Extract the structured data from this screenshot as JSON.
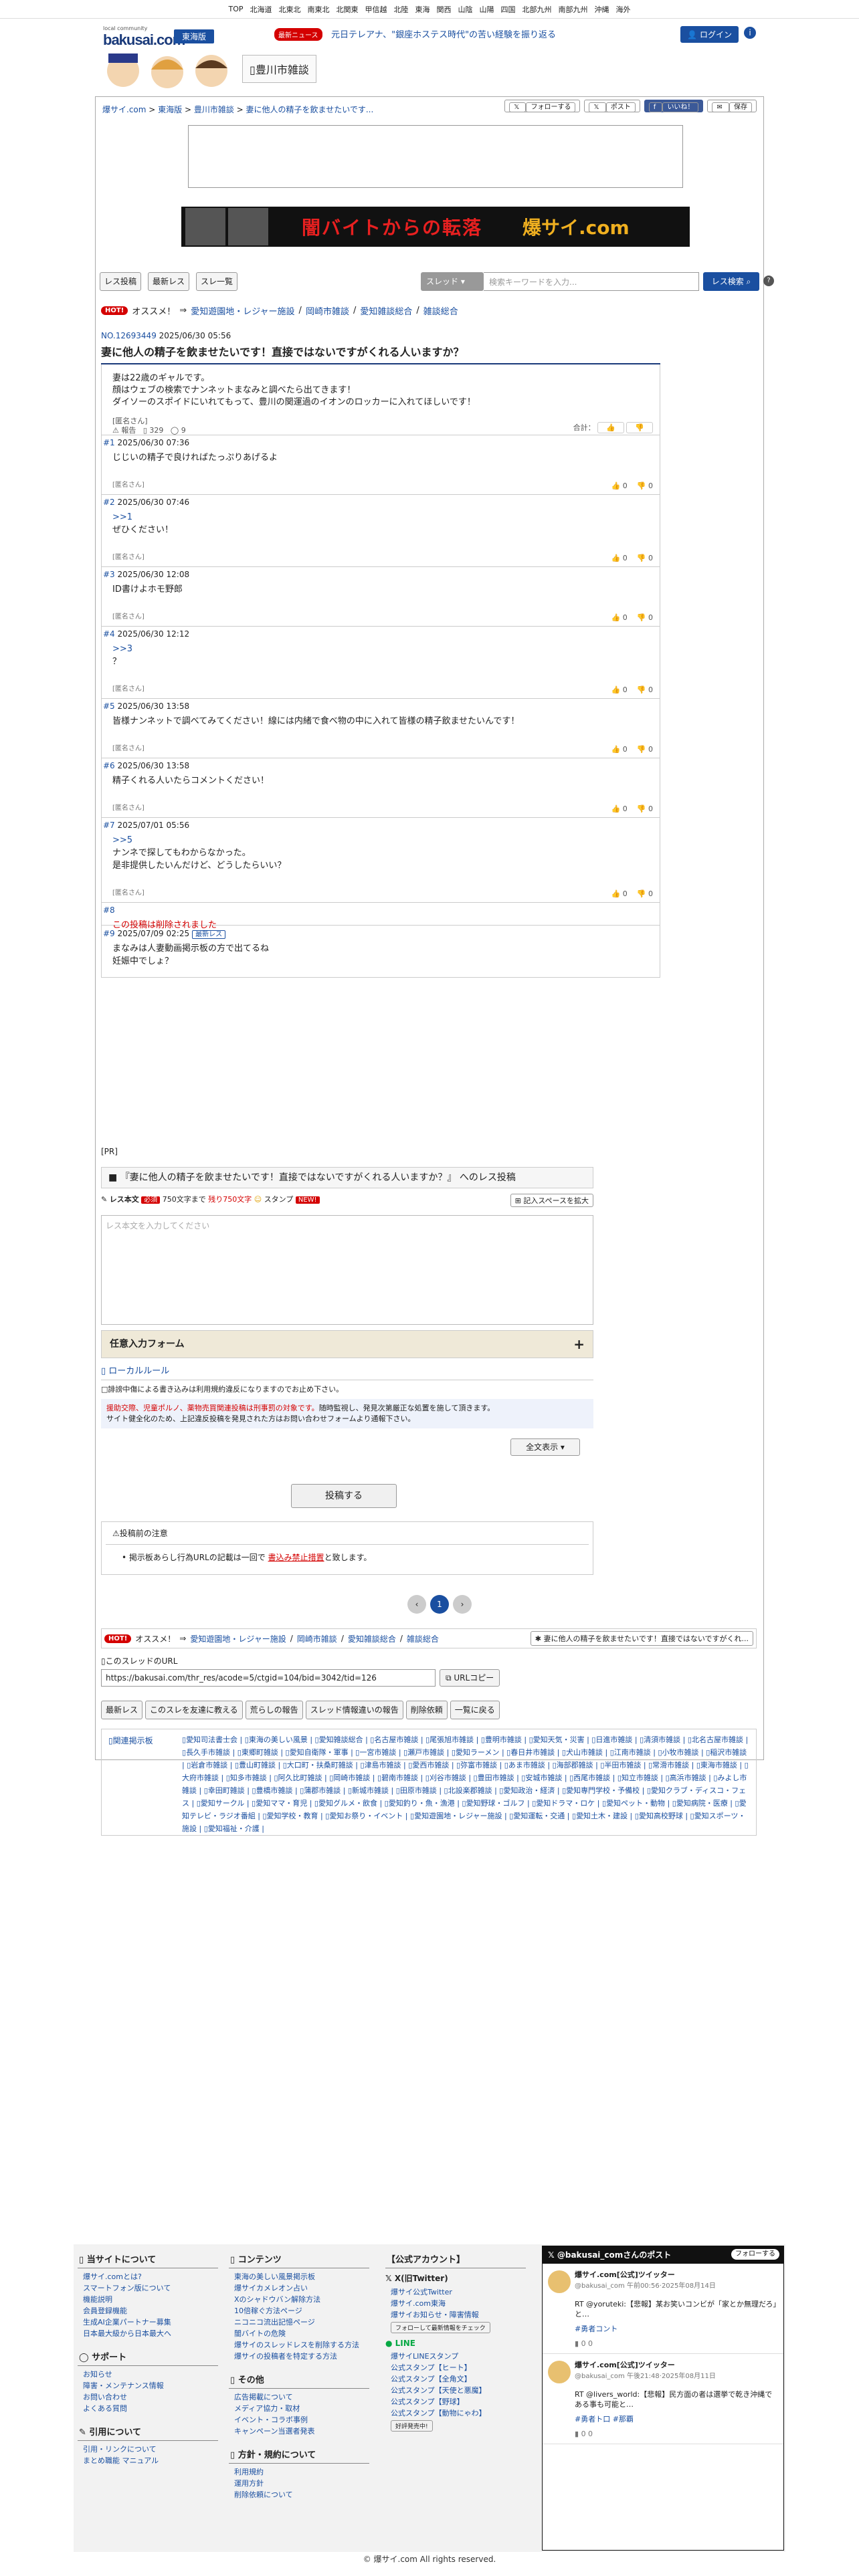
{
  "regions": [
    "TOP",
    "北海道",
    "北東北",
    "南東北",
    "北関東",
    "甲信越",
    "北陸",
    "東海",
    "関西",
    "山陰",
    "山陽",
    "四国",
    "北部九州",
    "南部九州",
    "沖縄",
    "海外"
  ],
  "header": {
    "logo_tiny": "local community",
    "logo": "bakusai.com",
    "edition": "東海版",
    "news_badge": "最新ニュース",
    "news_text": "元日テレアナ、\"銀座ホステス時代\"の苦い経験を振り返る",
    "login": "ログイン",
    "board": "豊川市雑談"
  },
  "breadcrumb": {
    "home": "爆サイ.com",
    "region": "東海版",
    "board": "豊川市雑談",
    "thread": "妻に他人の精子を飲ませたいです..."
  },
  "share": {
    "x_follow": "フォローする",
    "x_post": "ポスト",
    "fb": "いいね！",
    "save": "保存"
  },
  "banner": {
    "left": "闇バイトからの転落",
    "right": "爆サイ.com"
  },
  "toolbar": {
    "post": "レス投稿",
    "latest": "最新レス",
    "list": "スレ一覧",
    "select": "スレッド",
    "search_placeholder": "検索キーワードを入力...",
    "search": "レス検索"
  },
  "recommend": {
    "hot": "HOT!",
    "label": "オススメ！",
    "arrow": "⇒",
    "links": [
      "愛知遊園地・レジャー施設",
      "岡崎市雑談",
      "愛知雑談総合",
      "雑談総合"
    ]
  },
  "thread": {
    "no": "NO.12693449",
    "date": "2025/06/30 05:56",
    "title": "妻に他人の精子を飲ませたいです！直接ではないですがくれる人いますか？",
    "body": [
      "妻は22歳のギャルです。",
      "顔はウェブの検索でナンネットまなみと調べたら出てきます！",
      "ダイソーのスポイドにいれてもって、豊川の関運過のイオンのロッカーに入れてほしいです！"
    ],
    "name": "[匿名さん]",
    "report": "報告",
    "views": "329",
    "comments": "9",
    "total": "合計："
  },
  "responses": [
    {
      "no": "#1",
      "date": "2025/06/30 07:36",
      "lines": [
        "じじいの精子で良ければたっぷりあげるよ"
      ],
      "name": "[匿名さん]",
      "up": "0",
      "down": "0"
    },
    {
      "no": "#2",
      "date": "2025/06/30 07:46",
      "anchor": ">>1",
      "lines": [
        "ぜひください！"
      ],
      "name": "[匿名さん]",
      "up": "0",
      "down": "0"
    },
    {
      "no": "#3",
      "date": "2025/06/30 12:08",
      "lines": [
        "ID書けよホモ野郎"
      ],
      "name": "[匿名さん]",
      "up": "0",
      "down": "0"
    },
    {
      "no": "#4",
      "date": "2025/06/30 12:12",
      "anchor": ">>3",
      "lines": [
        "？"
      ],
      "name": "[匿名さん]",
      "up": "0",
      "down": "0"
    },
    {
      "no": "#5",
      "date": "2025/06/30 13:58",
      "lines": [
        "皆様ナンネットで調べてみてください！線には内緒で食べ物の中に入れて皆様の精子飲ませたいんです！"
      ],
      "name": "[匿名さん]",
      "up": "0",
      "down": "0"
    },
    {
      "no": "#6",
      "date": "2025/06/30 13:58",
      "lines": [
        "精子くれる人いたらコメントください！"
      ],
      "name": "[匿名さん]",
      "up": "0",
      "down": "0"
    },
    {
      "no": "#7",
      "date": "2025/07/01 05:56",
      "anchor": ">>5",
      "lines": [
        "ナンネで探してもわからなかった。",
        "是非提供したいんだけど、どうしたらいい？"
      ],
      "name": "[匿名さん]",
      "up": "0",
      "down": "0"
    },
    {
      "no": "#8",
      "deleted": "この投稿は削除されました"
    },
    {
      "no": "#9",
      "date": "2025/07/09 02:25",
      "badge": "最新レス",
      "lines": [
        "まなみは人妻動画掲示板の方で出てるね",
        "妊娠中でしょ？"
      ]
    }
  ],
  "pr": "[PR]",
  "form": {
    "head": "『妻に他人の精子を飲ませたいです！直接ではないですがくれる人いますか？』 へのレス投稿",
    "label": "レス本文",
    "req": "必須",
    "limit": "750文字まで",
    "remain": "残り750文字",
    "stamp": "スタンプ",
    "new": "NEW!",
    "space": "記入スペースを拡大",
    "placeholder": "レス本文を入力してください",
    "optional": "任意入力フォーム",
    "plus": "+",
    "local_rule": "ローカルルール",
    "rule1": "誹謗中傷による書き込みは利用規約違反になりますのでお止め下さい。",
    "rule2_red": "援助交際、児童ポルノ、薬物売買関連投稿は刑事罰の対象です。",
    "rule2": "随時監視し、発見次第厳正な処置を施して頂きます。",
    "rule3": "サイト健全化のため、上記違反投稿を発見された方はお問い合わせフォームより通報下さい。",
    "full": "全文表示",
    "submit": "投稿する",
    "caution": "投稿前の注意",
    "caution_text": "掲示板あらし行為URLの記載は一回で",
    "caution_strong": "書込み禁止措置",
    "caution_end": "と致します。"
  },
  "pager": {
    "prev": "‹",
    "current": "1",
    "next": "›"
  },
  "recommend2_side": "妻に他人の精子を飲ませたいです！直接ではないですがくれ...",
  "url": {
    "label": "このスレッドのURL",
    "value": "https://bakusai.com/thr_res/acode=5/ctgid=104/bid=3042/tid=126",
    "copy": "URLコピー"
  },
  "actions": [
    "最新レス",
    "このスレを友達に教える",
    "荒らしの報告",
    "スレッド情報違いの報告",
    "削除依頼",
    "一覧に戻る"
  ],
  "related": {
    "label": "関連掲示板",
    "links": [
      "愛知司法書士会",
      "東海の美しい風景",
      "愛知雑談総合",
      "名古屋市雑談",
      "尾張旭市雑談",
      "豊明市雑談",
      "愛知天気・災害",
      "日進市雑談",
      "清須市雑談",
      "北名古屋市雑談",
      "長久手市雑談",
      "東郷町雑談",
      "愛知自衛隊・軍事",
      "一宮市雑談",
      "瀬戸市雑談",
      "愛知ラーメン",
      "春日井市雑談",
      "犬山市雑談",
      "江南市雑談",
      "小牧市雑談",
      "稲沢市雑談",
      "岩倉市雑談",
      "豊山町雑談",
      "大口町・扶桑町雑談",
      "津島市雑談",
      "愛西市雑談",
      "弥富市雑談",
      "あま市雑談",
      "海部郡雑談",
      "半田市雑談",
      "常滑市雑談",
      "東海市雑談",
      "大府市雑談",
      "知多市雑談",
      "阿久比町雑談",
      "岡崎市雑談",
      "碧南市雑談",
      "刈谷市雑談",
      "豊田市雑談",
      "安城市雑談",
      "西尾市雑談",
      "知立市雑談",
      "高浜市雑談",
      "みよし市雑談",
      "幸田町雑談",
      "豊橋市雑談",
      "蒲郡市雑談",
      "新城市雑談",
      "田原市雑談",
      "北設楽郡雑談",
      "愛知政治・経済",
      "愛知専門学校・予備校",
      "愛知クラブ・ディスコ・フェス",
      "愛知サークル",
      "愛知ママ・育児",
      "愛知グルメ・飲食",
      "愛知釣り・魚・漁港",
      "愛知野球・ゴルフ",
      "愛知ドラマ・ロケ",
      "愛知ペット・動物",
      "愛知病院・医療",
      "愛知テレビ・ラジオ番組",
      "愛知学校・教育",
      "愛知お祭り・イベント",
      "愛知遊園地・レジャー施設",
      "愛知運転・交通",
      "愛知土木・建設",
      "愛知高校野球",
      "愛知スポーツ・施設",
      "愛知福祉・介護"
    ]
  },
  "footer": {
    "about": {
      "title": "当サイトについて",
      "items": [
        "爆サイ.comとは?",
        "スマートフォン版について",
        "機能説明",
        "会員登録機能",
        "生成AI企業パートナー募集",
        "日本最大級から日本最大へ"
      ]
    },
    "content": {
      "title": "コンテンツ",
      "items": [
        "東海の美しい風景掲示板",
        "爆サイカメレオン占い",
        "Xのシャドウバン解除方法",
        "10倍稼ぐ方法ページ",
        "ニコニコ流出記憶ページ",
        "闇バイトの危険",
        "爆サイのスレッドレスを削除する方法",
        "爆サイの投稿者を特定する方法"
      ]
    },
    "support": {
      "title": "サポート",
      "items": [
        "お知らせ",
        "障害・メンテナンス情報",
        "お問い合わせ",
        "よくある質問"
      ]
    },
    "other": {
      "title": "その他",
      "items": [
        "広告掲載について",
        "メディア協力・取材",
        "イベント・コラボ事例",
        "キャンペーン当選者発表"
      ]
    },
    "refer": {
      "title": "引用について",
      "items": [
        "引用・リンクについて",
        "まとめ職能 マニュアル"
      ]
    },
    "policy": {
      "title": "方針・規約について",
      "items": [
        "利用規約",
        "運用方針",
        "削除依頼について"
      ]
    },
    "accounts": {
      "title": "公式アカウント",
      "x_title": "X(旧Twitter)",
      "x_items": [
        "爆サイ公式Twitter",
        "爆サイ.com東海",
        "爆サイお知らせ・障害情報"
      ],
      "follow_note": "フォローして最新情報をチェック",
      "line_title": "LINE",
      "line_items": [
        "爆サイLINEスタンプ",
        "公式スタンプ【ヒート】",
        "公式スタンプ【全角文】",
        "公式スタンプ【天使と悪魔】",
        "公式スタンプ【野球】",
        "公式スタンプ【動物にゃわ】"
      ],
      "line_note": "好評発売中!"
    },
    "xfeed": {
      "title": "@bakusai_comさんのポスト",
      "follow": "フォローする",
      "tweets": [
        {
          "name": "爆サイ.com[公式]ツイッター",
          "meta": "@bakusai_com 午前00:56·2025年08月14日",
          "body": "RT @yoruteki:【悲報】某お笑いコンビが「家とか無理だろ」と…",
          "tag": "#勇者コント",
          "stats": "0  0"
        },
        {
          "name": "爆サイ.com[公式]ツイッター",
          "meta": "@bakusai_com 午後21:48·2025年08月11日",
          "body": "RT @livers_world:【悲報】民方面の者は選挙で乾き沖縄である事も可能と…",
          "tag": "#勇者ト口 #那覇",
          "stats": "0  0"
        }
      ]
    }
  },
  "copyright": "© 爆サイ.com All rights reserved."
}
